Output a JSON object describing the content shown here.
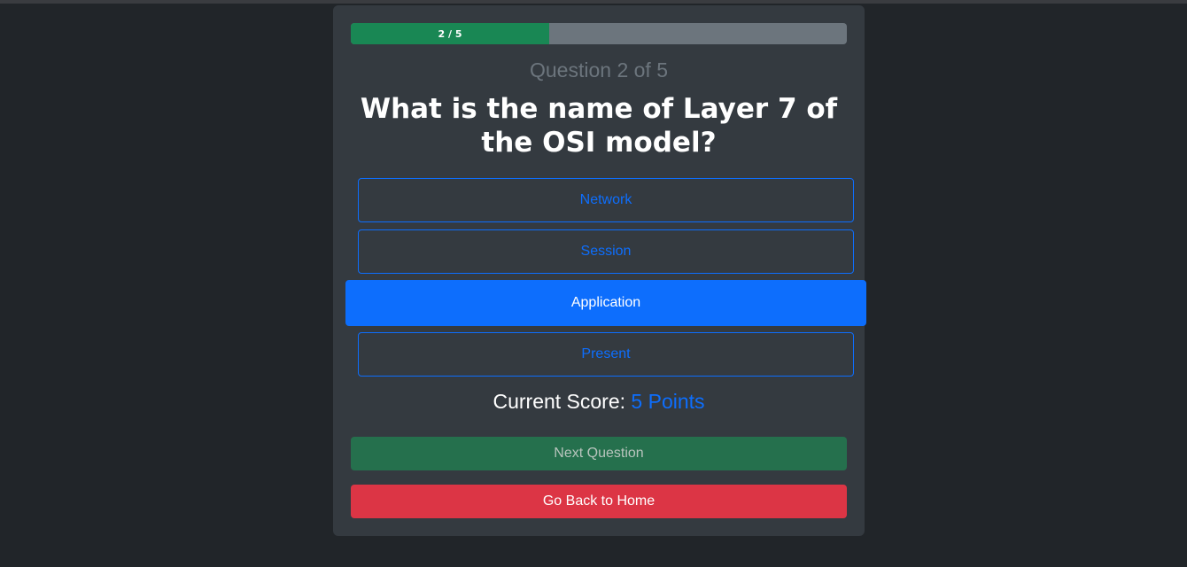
{
  "progress": {
    "label": "2 / 5",
    "fraction": 0.4
  },
  "question": {
    "number_label": "Question 2 of 5",
    "text": "What is the name of Layer 7 of the OSI model?"
  },
  "options": [
    {
      "label": "Network",
      "selected": false
    },
    {
      "label": "Session",
      "selected": false
    },
    {
      "label": "Application",
      "selected": true
    },
    {
      "label": "Present",
      "selected": false
    }
  ],
  "score": {
    "label": "Current Score:",
    "value": "5 Points"
  },
  "buttons": {
    "next": "Next Question",
    "home": "Go Back to Home"
  },
  "colors": {
    "page_bg": "#212529",
    "card_bg": "#343a40",
    "primary": "#0d6efd",
    "success": "#198754",
    "danger": "#dc3545",
    "muted": "#6c757d"
  }
}
